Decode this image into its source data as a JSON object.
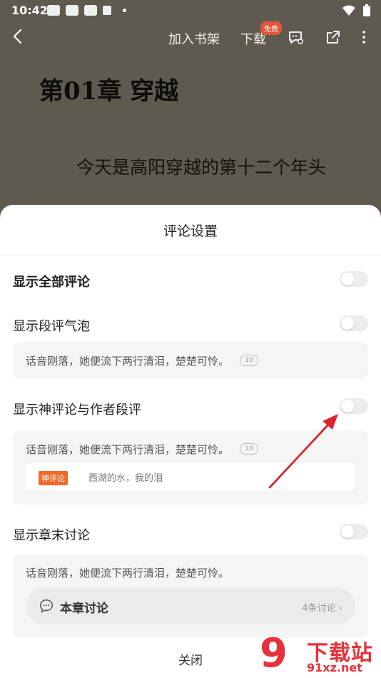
{
  "statusbar": {
    "time": "10:42"
  },
  "topbar": {
    "add_shelf": "加入书架",
    "download": "下载",
    "free_badge": "免费"
  },
  "reader": {
    "chapter_title": "第01章 穿越",
    "text": "今天是高阳穿越的第十二个年头"
  },
  "sheet": {
    "title": "评论设置",
    "rows": [
      {
        "label": "显示全部评论",
        "enabled": false
      },
      {
        "label": "显示段评气泡",
        "enabled": false
      },
      {
        "label": "显示神评论与作者段评",
        "enabled": false
      },
      {
        "label": "显示章末讨论",
        "enabled": false
      }
    ],
    "preview_text": "话音刚落，她便流下两行清泪，楚楚可怜。",
    "bubble_count": "10",
    "god_tag": "神评论",
    "god_text": "西湖的水，我的泪",
    "discuss_label": "本章讨论",
    "discuss_count": "4条讨论",
    "close": "关闭"
  },
  "watermark": {
    "title": "下载站",
    "url": "91xz.net"
  },
  "colors": {
    "reader_bg": "#5f5a50",
    "tag_orange": "#ef6a2a",
    "arrow_red": "#d7262e",
    "watermark_red": "#e8313b"
  }
}
